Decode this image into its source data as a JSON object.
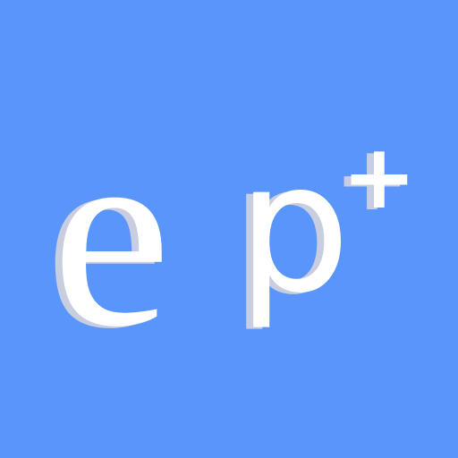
{
  "logo": {
    "text": "ep+",
    "colors": {
      "background": "#5a95fb",
      "glyph": "#ffffff",
      "shadow": "#c8cde0"
    }
  }
}
